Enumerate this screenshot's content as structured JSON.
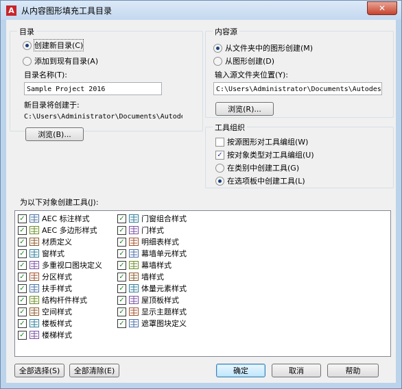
{
  "window": {
    "title": "从内容图形填充工具目录",
    "close_symbol": "✕",
    "app_icon": "A"
  },
  "catalog": {
    "group_label": "目录",
    "create_new": "创建新目录(C)",
    "add_existing": "添加到现有目录(A)",
    "name_label": "目录名称(T):",
    "name_value": "Sample Project 2016",
    "location_label": "新目录将创建于:",
    "location_value": "C:\\Users\\Administrator\\Documents\\Autodes",
    "browse": "浏览(B)..."
  },
  "source": {
    "group_label": "内容源",
    "from_folder": "从文件夹中的图形创建(M)",
    "from_drawing": "从图形创建(D)",
    "folder_label": "输入源文件夹位置(Y):",
    "folder_value": "C:\\Users\\Administrator\\Documents\\Autodes",
    "browse": "浏览(R)..."
  },
  "organization": {
    "group_label": "工具组织",
    "by_drawing": "按源图形对工具编组(W)",
    "by_object_type": "按对象类型对工具编组(U)",
    "in_category": "在类别中创建工具(G)",
    "in_palette": "在选项板中创建工具(L)"
  },
  "objects": {
    "label": "为以下对象创建工具(J):",
    "column1": [
      {
        "label": "AEC 标注样式",
        "icon": "dimension-style-icon"
      },
      {
        "label": "AEC 多边形样式",
        "icon": "polygon-style-icon"
      },
      {
        "label": "材质定义",
        "icon": "material-icon"
      },
      {
        "label": "窗样式",
        "icon": "window-style-icon"
      },
      {
        "label": "多重视口图块定义",
        "icon": "multi-view-block-icon"
      },
      {
        "label": "分区样式",
        "icon": "zone-style-icon"
      },
      {
        "label": "扶手样式",
        "icon": "railing-style-icon"
      },
      {
        "label": "结构杆件样式",
        "icon": "structural-member-icon"
      },
      {
        "label": "空间样式",
        "icon": "space-style-icon"
      },
      {
        "label": "楼板样式",
        "icon": "slab-style-icon"
      },
      {
        "label": "楼梯样式",
        "icon": "stair-style-icon"
      }
    ],
    "column2": [
      {
        "label": "门窗组合样式",
        "icon": "door-window-assembly-icon"
      },
      {
        "label": "门样式",
        "icon": "door-style-icon"
      },
      {
        "label": "明细表样式",
        "icon": "schedule-table-icon"
      },
      {
        "label": "幕墙单元样式",
        "icon": "curtain-wall-unit-icon"
      },
      {
        "label": "幕墙样式",
        "icon": "curtain-wall-icon"
      },
      {
        "label": "墙样式",
        "icon": "wall-style-icon"
      },
      {
        "label": "体量元素样式",
        "icon": "mass-element-icon"
      },
      {
        "label": "屋顶板样式",
        "icon": "roof-slab-icon"
      },
      {
        "label": "显示主题样式",
        "icon": "display-theme-icon"
      },
      {
        "label": "遮罩图块定义",
        "icon": "mask-block-icon"
      }
    ]
  },
  "buttons": {
    "select_all": "全部选择(S)",
    "clear_all": "全部清除(E)",
    "ok": "确定",
    "cancel": "取消",
    "help": "帮助"
  }
}
